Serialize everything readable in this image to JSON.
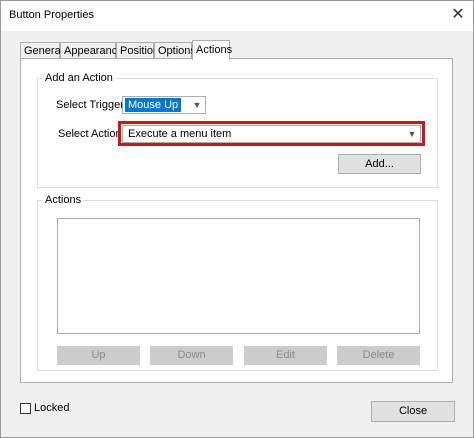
{
  "window": {
    "title": "Button Properties",
    "close_glyph": "✕"
  },
  "tabs": [
    {
      "label": "General",
      "active": false
    },
    {
      "label": "Appearance",
      "active": false
    },
    {
      "label": "Position",
      "active": false
    },
    {
      "label": "Options",
      "active": false
    },
    {
      "label": "Actions",
      "active": true
    }
  ],
  "add_action": {
    "group_label": "Add an Action",
    "trigger_label": "Select Trigger:",
    "trigger_value": "Mouse Up",
    "action_label": "Select Action:",
    "action_value": "Execute a menu item",
    "add_button": "Add...",
    "highlight_color": "#d2131d"
  },
  "actions": {
    "group_label": "Actions",
    "items": [],
    "buttons": {
      "up": "Up",
      "down": "Down",
      "edit": "Edit",
      "delete": "Delete"
    }
  },
  "footer": {
    "locked_label": "Locked",
    "locked_checked": false,
    "close_button": "Close"
  },
  "icons": {
    "close": "close-icon",
    "dropdown": "chevron-down-icon"
  }
}
